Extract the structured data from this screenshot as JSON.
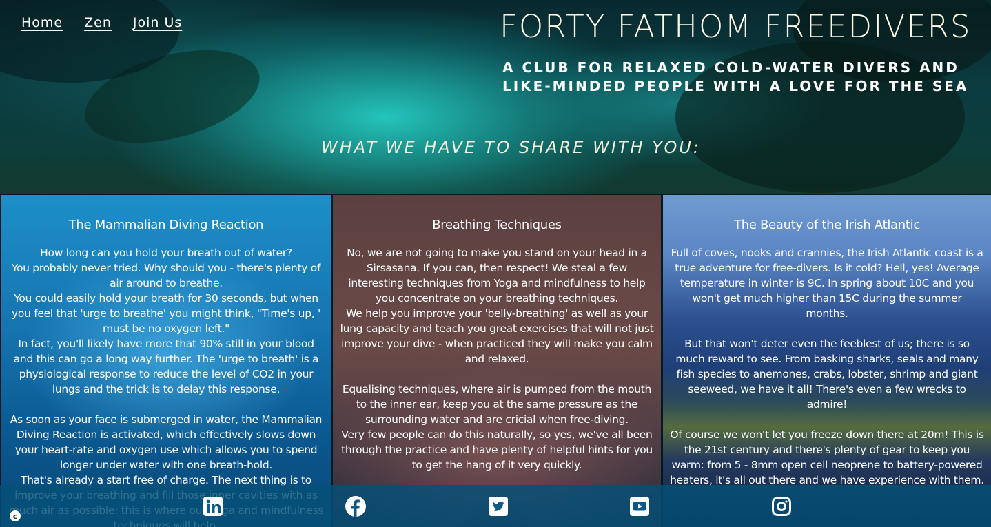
{
  "nav": {
    "items": [
      {
        "label": "Home"
      },
      {
        "label": "Zen"
      },
      {
        "label": "Join Us"
      }
    ]
  },
  "header": {
    "title": "FORTY FATHOM FREEDIVERS",
    "tagline_line1": "A CLUB FOR RELAXED COLD-WATER DIVERS AND",
    "tagline_line2": "LIKE-MINDED PEOPLE WITH A LOVE FOR THE SEA",
    "share_heading": "WHAT WE HAVE TO SHARE WITH YOU:"
  },
  "cards": [
    {
      "title": "The Mammalian Diving Reaction",
      "paragraphs": [
        "How long can you hold your breath out of water?",
        "You probably never tried. Why should you - there's plenty of air around to breathe.",
        "You could easily hold your breath for 30 seconds, but when you feel that 'urge to breathe' you might think, \"Time's up, ' must be no oxygen left.\"",
        "In fact, you'll likely have more that 90% still in your blood and this can go a long way further. The 'urge to breath' is a physiological response to reduce the level of CO2 in your lungs and the trick is to delay this response.",
        "",
        "As soon as your face is submerged in water, the Mammalian Diving Reaction is activated, which effectively slows down your heart-rate and oxygen use which allows you to spend longer under water with one breath-hold.",
        "That's already a start free of charge. The next thing is to improve your breathing and fill those inner cavities with as much air as possible: this is where our yoga and mindfulness techniques will help."
      ]
    },
    {
      "title": "Breathing Techniques",
      "paragraphs": [
        "No, we are not going to make you stand on your head in a Sirsasana. If you can, then respect! We steal a few interesting techniques from Yoga and mindfulness to help you concentrate on your breathing techniques.",
        "We help you improve your 'belly-breathing' as well as your lung capacity and teach you great exercises that will not just improve your dive - when practiced they will make you calm and relaxed.",
        "",
        "Equalising techniques, where air is pumped from the mouth to the inner ear, keep you at the same pressure as the surrounding water and are cricial when free-diving.",
        "Very few people can do this naturally, so yes, we've all been through the practice and have plenty of helpful hints for you to get the hang of it very quickly."
      ]
    },
    {
      "title": "The Beauty of the Irish Atlantic",
      "paragraphs": [
        "Full of coves, nooks and crannies, the Irish Atlantic coast is a true adventure for free-divers. Is it cold? Hell, yes! Average temperature in winter is 9C. In spring about 10C and you won't get much higher than 15C during the summer months.",
        "",
        "But that won't deter even the feeblest of us; there is so much reward to see. From basking sharks, seals and many fish species to anemones, crabs, lobster, shrimp and giant seeweed, we have it all! There's even a few wrecks to admire!",
        "",
        "Of course we won't let you freeze down there at 20m! This is the 21st century and there's plenty of gear to keep you warm: from 5 - 8mm open cell neoprene to battery-powered heaters, it's all out there and we have experience with them."
      ]
    }
  ],
  "footer": {
    "icons": [
      "linkedin-icon",
      "facebook-icon",
      "twitter-icon",
      "youtube-icon",
      "instagram-icon"
    ]
  },
  "cookie_badge": "c",
  "colors": {
    "footer_bg": "#05507a",
    "title_color": "#fffbe6"
  }
}
